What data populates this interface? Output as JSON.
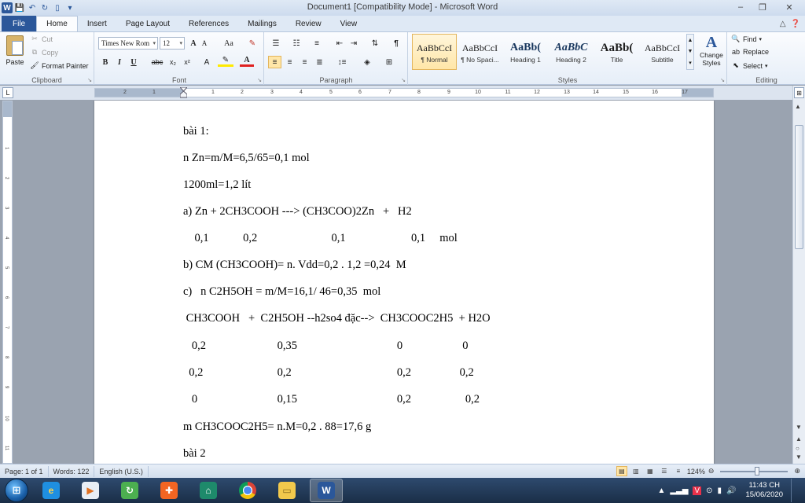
{
  "window": {
    "title": "Document1 [Compatibility Mode] - Microsoft Word",
    "controls": [
      "–",
      "❐",
      "✕"
    ]
  },
  "quick_access": {
    "app_letter": "W"
  },
  "tabs": [
    {
      "label": "File"
    },
    {
      "label": "Home"
    },
    {
      "label": "Insert"
    },
    {
      "label": "Page Layout"
    },
    {
      "label": "References"
    },
    {
      "label": "Mailings"
    },
    {
      "label": "Review"
    },
    {
      "label": "View"
    }
  ],
  "ribbon": {
    "clipboard": {
      "label": "Clipboard",
      "paste": "Paste",
      "cut": "Cut",
      "copy": "Copy",
      "format_painter": "Format Painter"
    },
    "font": {
      "label": "Font",
      "font_name": "Times New Rom",
      "font_size": "12",
      "grow": "A",
      "shrink": "A",
      "change_case": "Aa",
      "bold": "B",
      "italic": "I",
      "underline": "U",
      "strike": "abc",
      "subscript": "x₂",
      "superscript": "x²"
    },
    "paragraph": {
      "label": "Paragraph"
    },
    "styles": {
      "label": "Styles",
      "items": [
        {
          "sample": "AaBbCcI",
          "name": "¶ Normal"
        },
        {
          "sample": "AaBbCcI",
          "name": "¶ No Spaci..."
        },
        {
          "sample": "AaBb(",
          "name": "Heading 1"
        },
        {
          "sample": "AaBbC",
          "name": "Heading 2"
        },
        {
          "sample": "AaBb(",
          "name": "Title"
        },
        {
          "sample": "AaBbCcI",
          "name": "Subtitle"
        }
      ],
      "change_styles": "Change Styles"
    },
    "editing": {
      "label": "Editing",
      "find": "Find",
      "replace": "Replace",
      "select": "Select"
    }
  },
  "ruler": {
    "ticks": [
      "2",
      "1",
      "1",
      "2",
      "3",
      "4",
      "5",
      "6",
      "7",
      "8",
      "9",
      "10",
      "11",
      "12",
      "13",
      "14",
      "15",
      "16",
      "17"
    ],
    "vticks": [
      "1",
      "2",
      "3",
      "4",
      "5",
      "6",
      "7",
      "8",
      "9",
      "10",
      "11"
    ]
  },
  "document": {
    "lines": [
      "bài 1:",
      "n Zn=m/M=6,5/65=0,1 mol",
      "1200ml=1,2 lít",
      "a) Zn + 2CH3COOH ---> (CH3COO)2Zn   +   H2",
      "    0,1            0,2                          0,1                       0,1     mol",
      "b) CM (CH3COOH)= n. Vdd=0,2 . 1,2 =0,24  M",
      "c)   n C2H5OH = m/M=16,1/ 46=0,35  mol",
      " CH3COOH   +  C2H5OH --h2so4 đặc-->  CH3COOC2H5  + H2O",
      "   0,2                         0,35                                   0                     0",
      "  0,2                          0,2                                     0,2                 0,2",
      "   0                            0,15                                   0,2                   0,2",
      "m CH3COOC2H5= n.M=0,2 . 88=17,6 g",
      "bài 2"
    ]
  },
  "statusbar": {
    "page": "Page: 1 of 1",
    "words": "Words: 122",
    "language": "English (U.S.)",
    "zoom": "124%"
  },
  "taskbar": {
    "clock_time": "11:43 CH",
    "clock_date": "15/06/2020"
  },
  "colors": {
    "file_tab": "#2b579a",
    "taskbar": "#1a2e47",
    "selected_style": "#ffe6a8"
  }
}
